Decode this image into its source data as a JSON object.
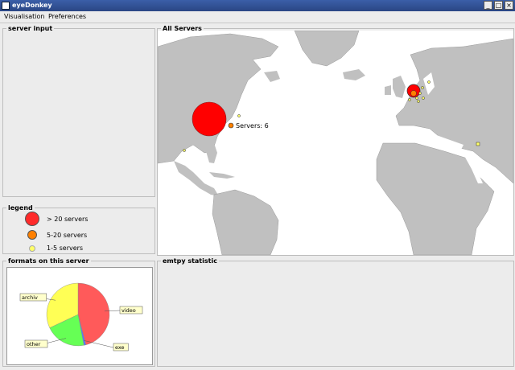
{
  "window": {
    "title": "eyeDonkey",
    "icon": "app-icon"
  },
  "window_buttons": [
    "_",
    "□",
    "×"
  ],
  "menu": {
    "items": [
      "Visualisation",
      "Preferences"
    ]
  },
  "panels": {
    "server_input": "server input",
    "all_servers": "All Servers",
    "legend": "legend",
    "formats": "formats on this server",
    "empty_stat": "emtpy statistic"
  },
  "legend": {
    "items": [
      {
        "label": "> 20 servers",
        "color": "#ff2a2a"
      },
      {
        "label": "5-20 servers",
        "color": "#ff8000"
      },
      {
        "label": "1-5  servers",
        "color": "#ffff66"
      }
    ]
  },
  "map": {
    "tooltip": "Servers: 6",
    "colors": {
      "water": "#ffffff",
      "land": "#c0c0c0",
      "big": "#ff0000",
      "mid": "#ff8000",
      "small": "#ffff66"
    }
  },
  "chart_data": {
    "type": "pie",
    "categories": [
      "video",
      "exe",
      "other",
      "archiv"
    ],
    "values": [
      46,
      1,
      21,
      32
    ],
    "colors": [
      "#ff5a5a",
      "#5577ff",
      "#66ff55",
      "#ffff55"
    ]
  }
}
